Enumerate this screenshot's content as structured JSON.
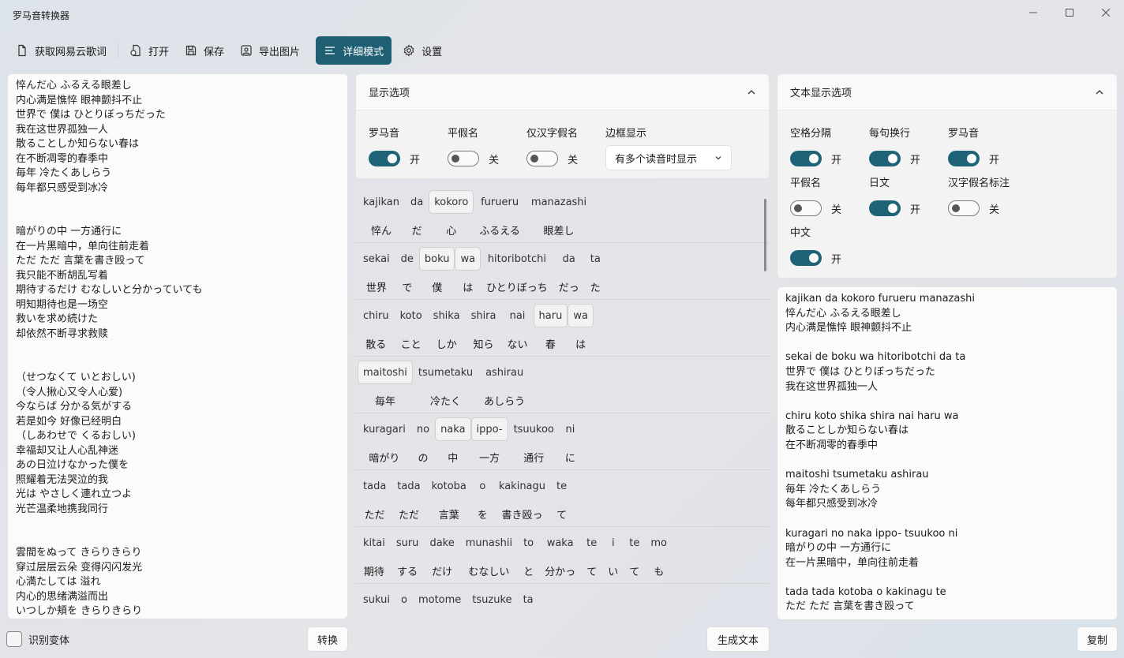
{
  "app": {
    "title": "罗马音转换器"
  },
  "toolbar": {
    "fetch_label": "获取网易云歌词",
    "open_label": "打开",
    "save_label": "保存",
    "export_label": "导出图片",
    "detail_label": "详细模式",
    "settings_label": "设置"
  },
  "lyrics": [
    "悴んだ心 ふるえる眼差し",
    "内心满是憔悴 眼神颤抖不止",
    "世界で 僕は ひとりぼっちだった",
    "我在这世界孤独一人",
    "散ることしか知らない春は",
    "在不断凋零的春季中",
    "毎年 冷たくあしらう",
    "每年都只感受到冰冷",
    "",
    "",
    "暗がりの中 一方通行に",
    "在一片黑暗中，单向往前走着",
    "ただ ただ 言葉を書き殴って",
    "我只能不断胡乱写着",
    "期待するだけ むなしいと分かっていても",
    "明知期待也是一场空",
    "救いを求め続けた",
    "却依然不断寻求救赎",
    "",
    "",
    "（せつなくて いとおしい)",
    "（令人揪心又令人心爱)",
    "今ならば 分かる気がする",
    "若是如今 好像已经明白",
    "（しあわせで くるおしい)",
    "幸福却又让人心乱神迷",
    "あの日泣けなかった僕を",
    "照耀着无法哭泣的我",
    "光は やさしく連れ立つよ",
    "光芒温柔地携我同行",
    "",
    "",
    "雲間をぬって きらりきらり",
    "穿过层层云朵 变得闪闪发光",
    "心満たしては 溢れ",
    "内心的思绪满溢而出",
    "いつしか頬を きらりきらり"
  ],
  "display_options": {
    "title": "显示选项",
    "romaji": {
      "label": "罗马音",
      "state": "开"
    },
    "hiragana": {
      "label": "平假名",
      "state": "关"
    },
    "kanji_only": {
      "label": "仅汉字假名",
      "state": "关"
    },
    "border": {
      "label": "边框显示",
      "value": "有多个读音时显示"
    }
  },
  "text_options": {
    "title": "文本显示选项",
    "space_sep": {
      "label": "空格分隔",
      "state": "开"
    },
    "line_break": {
      "label": "每句换行",
      "state": "开"
    },
    "romaji": {
      "label": "罗马音",
      "state": "开"
    },
    "hiragana": {
      "label": "平假名",
      "state": "关"
    },
    "japanese": {
      "label": "日文",
      "state": "开"
    },
    "kanji_kana": {
      "label": "汉字假名标注",
      "state": "关"
    },
    "chinese": {
      "label": "中文",
      "state": "开"
    }
  },
  "words": [
    [
      [
        "kajikan",
        "悴ん",
        0
      ],
      [
        "da",
        "だ",
        0
      ],
      [
        "kokoro",
        "心",
        1
      ],
      [
        "furueru",
        "ふるえる",
        0
      ],
      [
        "manazashi",
        "眼差し",
        0
      ]
    ],
    [
      [
        "sekai",
        "世界",
        0
      ],
      [
        "de",
        "で",
        0
      ],
      [
        "boku",
        "僕",
        1
      ],
      [
        "wa",
        "は",
        1
      ],
      [
        "hitoribotchi",
        "ひとりぼっち",
        0
      ],
      [
        "da",
        "だっ",
        0
      ],
      [
        "ta",
        "た",
        0
      ]
    ],
    [
      [
        "chiru",
        "散る",
        0
      ],
      [
        "koto",
        "こと",
        0
      ],
      [
        "shika",
        "しか",
        0
      ],
      [
        "shira",
        "知ら",
        0
      ],
      [
        "nai",
        "ない",
        0
      ],
      [
        "haru",
        "春",
        1
      ],
      [
        "wa",
        "は",
        1
      ]
    ],
    [
      [
        "maitoshi",
        "毎年",
        1
      ],
      [
        "tsumetaku",
        "冷たく",
        0
      ],
      [
        "ashirau",
        "あしらう",
        0
      ]
    ],
    [
      [
        "kuragari",
        "暗がり",
        0
      ],
      [
        "no",
        "の",
        0
      ],
      [
        "naka",
        "中",
        1
      ],
      [
        "ippo-",
        "一方",
        1
      ],
      [
        "tsuukoo",
        "通行",
        0
      ],
      [
        "ni",
        "に",
        0
      ]
    ],
    [
      [
        "tada",
        "ただ",
        0
      ],
      [
        "tada",
        "ただ",
        0
      ],
      [
        "kotoba",
        "言葉",
        0
      ],
      [
        "o",
        "を",
        0
      ],
      [
        "kakinagu",
        "書き殴っ",
        0
      ],
      [
        "te",
        "て",
        0
      ]
    ],
    [
      [
        "kitai",
        "期待",
        0
      ],
      [
        "suru",
        "する",
        0
      ],
      [
        "dake",
        "だけ",
        0
      ],
      [
        "munashii",
        "むなしい",
        0
      ],
      [
        "to",
        "と",
        0
      ],
      [
        "waka",
        "分かっ",
        0
      ],
      [
        "te",
        "て",
        0
      ],
      [
        "i",
        "い",
        0
      ],
      [
        "te",
        "て",
        0
      ],
      [
        "mo",
        "も",
        0
      ]
    ],
    [
      [
        "sukui",
        "",
        0
      ],
      [
        "o",
        "",
        0
      ],
      [
        "motome",
        "",
        0
      ],
      [
        "tsuzuke",
        "",
        0
      ],
      [
        "ta",
        "",
        0
      ]
    ]
  ],
  "output": [
    "kajikan da kokoro furueru manazashi",
    "悴んだ心 ふるえる眼差し",
    "内心满是憔悴 眼神颤抖不止",
    "",
    "sekai de boku wa hitoribotchi da ta",
    "世界で 僕は ひとりぼっちだった",
    "我在这世界孤独一人",
    "",
    "chiru koto shika shira nai haru wa",
    "散ることしか知らない春は",
    "在不断凋零的春季中",
    "",
    "maitoshi tsumetaku ashirau",
    "毎年 冷たくあしらう",
    "每年都只感受到冰冷",
    "",
    "kuragari no naka ippo- tsuukoo ni",
    "暗がりの中 一方通行に",
    "在一片黑暗中，单向往前走着",
    "",
    "tada tada kotoba o kakinagu te",
    "ただ ただ 言葉を書き殴って"
  ],
  "bottom": {
    "variant_label": "识别变体",
    "convert_label": "转换",
    "generate_label": "生成文本",
    "copy_label": "复制"
  }
}
